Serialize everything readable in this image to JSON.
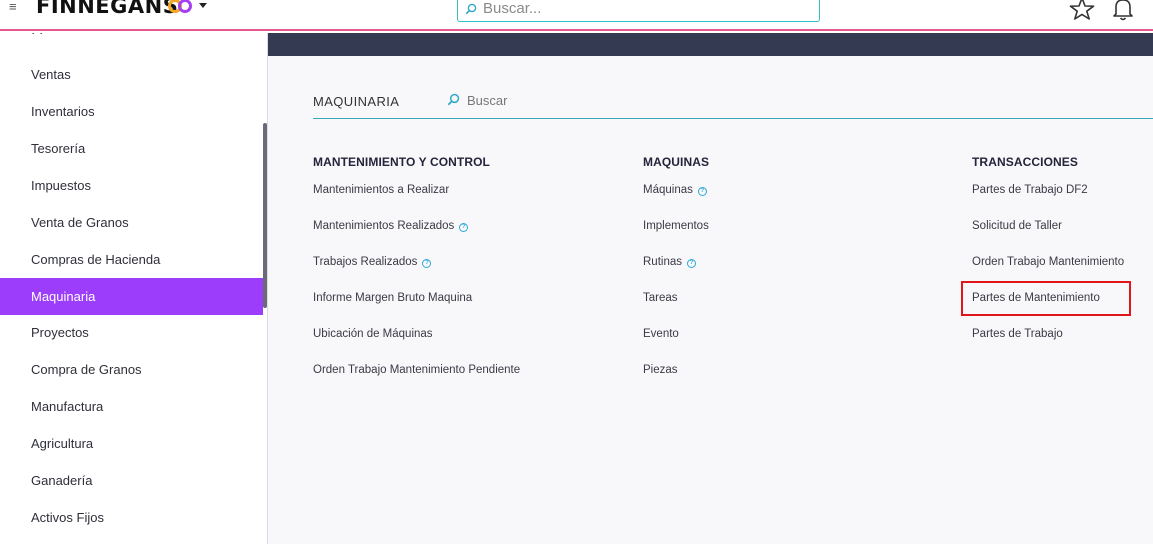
{
  "header": {
    "brand": "FINNEGANS",
    "search_placeholder": "Buscar..."
  },
  "sidebar": {
    "items": [
      {
        "label": "Ventas",
        "active": false
      },
      {
        "label": "Inventarios",
        "active": false
      },
      {
        "label": "Tesorería",
        "active": false
      },
      {
        "label": "Impuestos",
        "active": false
      },
      {
        "label": "Venta de Granos",
        "active": false
      },
      {
        "label": "Compras de Hacienda",
        "active": false
      },
      {
        "label": "Maquinaria",
        "active": true
      },
      {
        "label": "Proyectos",
        "active": false
      },
      {
        "label": "Compra de Granos",
        "active": false
      },
      {
        "label": "Manufactura",
        "active": false
      },
      {
        "label": "Agricultura",
        "active": false
      },
      {
        "label": "Ganadería",
        "active": false
      },
      {
        "label": "Activos Fijos",
        "active": false
      }
    ]
  },
  "main": {
    "module_title": "MAQUINARIA",
    "search_placeholder": "Buscar",
    "columns": [
      {
        "title": "MANTENIMIENTO Y CONTROL",
        "links": [
          {
            "label": "Mantenimientos a Realizar",
            "help": false
          },
          {
            "label": "Mantenimientos Realizados",
            "help": true
          },
          {
            "label": "Trabajos Realizados",
            "help": true
          },
          {
            "label": "Informe Margen Bruto Maquina",
            "help": false
          },
          {
            "label": "Ubicación de Máquinas",
            "help": false
          },
          {
            "label": "Orden Trabajo Mantenimiento Pendiente",
            "help": false
          }
        ]
      },
      {
        "title": "MAQUINAS",
        "links": [
          {
            "label": "Máquinas",
            "help": true
          },
          {
            "label": "Implementos",
            "help": false
          },
          {
            "label": "Rutinas",
            "help": true
          },
          {
            "label": "Tareas",
            "help": false
          },
          {
            "label": "Evento",
            "help": false
          },
          {
            "label": "Piezas",
            "help": false
          }
        ]
      },
      {
        "title": "TRANSACCIONES",
        "links": [
          {
            "label": "Partes de Trabajo DF2",
            "help": false
          },
          {
            "label": "Solicitud de Taller",
            "help": false
          },
          {
            "label": "Orden Trabajo Mantenimiento",
            "help": false
          },
          {
            "label": "Partes de Mantenimiento",
            "help": false,
            "highlighted": true
          },
          {
            "label": "Partes de Trabajo",
            "help": false
          }
        ]
      }
    ]
  },
  "colors": {
    "accent_purple": "#9b3dfb",
    "header_rule": "#e8578f",
    "search_border": "#30c2c2",
    "band": "#343a52",
    "highlight": "#e0161a"
  }
}
